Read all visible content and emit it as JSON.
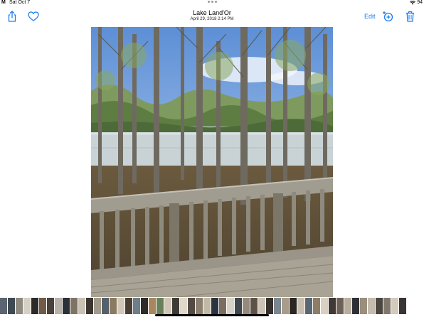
{
  "status_bar": {
    "time": "M",
    "date": "Sat Oct 7",
    "battery": "94"
  },
  "toolbar": {
    "title": "Lake Land'Or",
    "subtitle": "April 29, 2018   2:14 PM",
    "edit_label": "Edit",
    "icons": [
      "share-icon",
      "heart-icon",
      "add-to-album-icon",
      "trash-icon"
    ],
    "accent_color": "#1a7cf5"
  },
  "photo": {
    "subject": "wooden deck railing overlooking lake through trees"
  },
  "filmstrip": {
    "thumbnails": [
      {
        "color": "#5b6470"
      },
      {
        "color": "#3e4a52"
      },
      {
        "color": "#8f8a80"
      },
      {
        "color": "#d6cfc4"
      },
      {
        "color": "#2e2a28"
      },
      {
        "color": "#6f5b48"
      },
      {
        "color": "#48413c"
      },
      {
        "color": "#b9b2a8"
      },
      {
        "color": "#2c3038"
      },
      {
        "color": "#7e7466"
      },
      {
        "color": "#c9c1b4"
      },
      {
        "color": "#3b3532"
      },
      {
        "color": "#a39a8c"
      },
      {
        "color": "#55606a"
      },
      {
        "color": "#8b7a62"
      },
      {
        "color": "#d2c8b8"
      },
      {
        "color": "#4a3f35"
      },
      {
        "color": "#6d7f88"
      },
      {
        "color": "#2f2b29"
      },
      {
        "color": "#a9875e"
      },
      {
        "color": "#6a7f5a"
      },
      {
        "color": "#cfc6b6"
      },
      {
        "color": "#3e3a38"
      },
      {
        "color": "#e0d8ca"
      },
      {
        "color": "#524a44"
      },
      {
        "color": "#8a7f70"
      },
      {
        "color": "#c2b8a6"
      },
      {
        "color": "#2b3340"
      },
      {
        "color": "#7b6e5e"
      },
      {
        "color": "#d7d2c8"
      },
      {
        "color": "#40464e"
      },
      {
        "color": "#948a7c"
      },
      {
        "color": "#5e5248"
      },
      {
        "color": "#cbc3b5"
      },
      {
        "color": "#36302c"
      },
      {
        "color": "#7a8690"
      },
      {
        "color": "#a89c8a"
      },
      {
        "color": "#2a2624"
      },
      {
        "color": "#c8beb0"
      },
      {
        "color": "#5a6672"
      },
      {
        "color": "#8e7d66"
      },
      {
        "color": "#d9d0c2"
      },
      {
        "color": "#3f3834"
      },
      {
        "color": "#6e6258"
      },
      {
        "color": "#b8ae9e"
      },
      {
        "color": "#2d2f36"
      },
      {
        "color": "#9a8e7c"
      },
      {
        "color": "#c4bcae"
      },
      {
        "color": "#4b4641"
      },
      {
        "color": "#80786c"
      },
      {
        "color": "#d3cabc"
      },
      {
        "color": "#373433"
      }
    ]
  }
}
